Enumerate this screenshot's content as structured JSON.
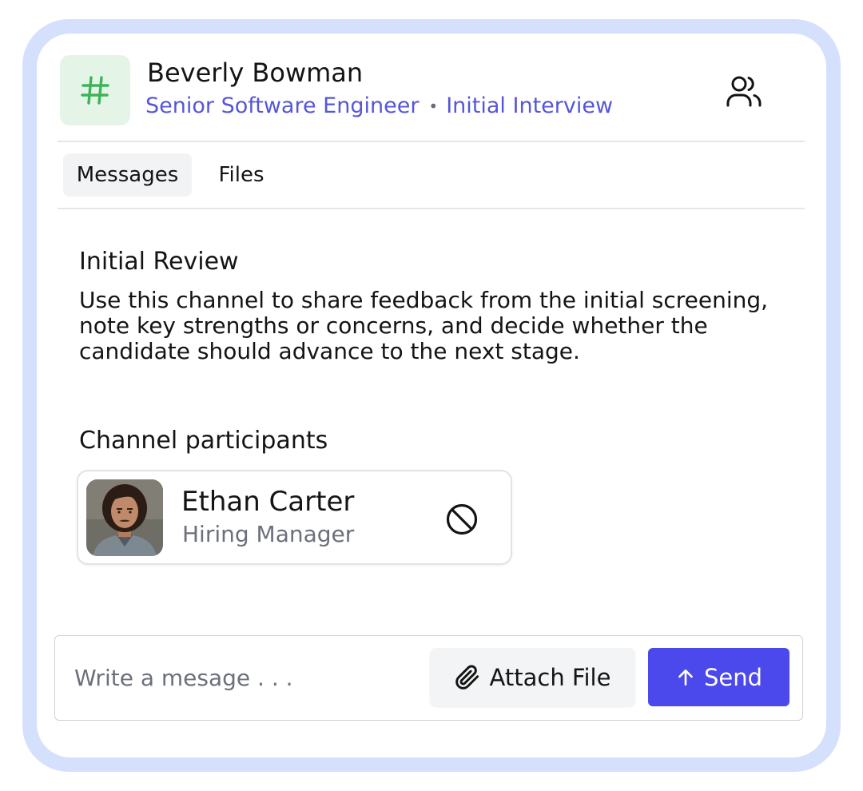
{
  "header": {
    "channel_icon": "hash-icon",
    "candidate_name": "Beverly Bowman",
    "job_title": "Senior Software Engineer",
    "separator": "•",
    "stage": "Initial Interview",
    "members_icon": "users-icon"
  },
  "tabs": [
    {
      "label": "Messages",
      "active": true
    },
    {
      "label": "Files",
      "active": false
    }
  ],
  "channel": {
    "title": "Initial Review",
    "description": "Use this channel to share feedback from the initial screening, note key strengths or concerns, and decide whether the candidate should advance to the next stage."
  },
  "participants": {
    "heading": "Channel participants",
    "items": [
      {
        "name": "Ethan Carter",
        "role": "Hiring Manager",
        "action_icon": "block-icon"
      }
    ]
  },
  "composer": {
    "placeholder": "Write a mesage . . .",
    "value": "",
    "attach_label": "Attach File",
    "send_label": "Send"
  },
  "colors": {
    "frame": "#d5e1fc",
    "accent": "#4b48ec",
    "link": "#5556d9",
    "hash": "#3fb35a",
    "badge_bg": "#e4f5e7"
  }
}
